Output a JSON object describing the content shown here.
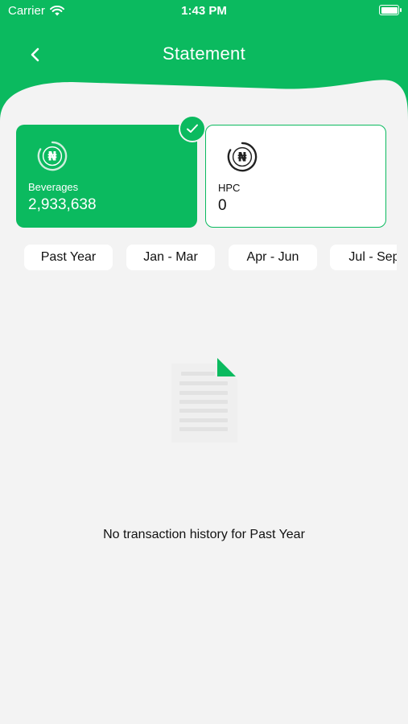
{
  "status_bar": {
    "carrier": "Carrier",
    "time": "1:43 PM"
  },
  "header": {
    "title": "Statement",
    "back_icon": "chevron-left-icon"
  },
  "colors": {
    "brand_green": "#0bba5f",
    "background": "#f3f3f3"
  },
  "cards": [
    {
      "label": "Beverages",
      "value": "2,933,638",
      "selected": true,
      "icon": "naira-icon"
    },
    {
      "label": "HPC",
      "value": "0",
      "selected": false,
      "icon": "naira-icon"
    }
  ],
  "periods": [
    {
      "label": "Past Year"
    },
    {
      "label": "Jan - Mar"
    },
    {
      "label": "Apr - Jun"
    },
    {
      "label": "Jul - Sep"
    }
  ],
  "empty_state": {
    "message": "No transaction history for Past Year",
    "icon": "document-icon"
  }
}
